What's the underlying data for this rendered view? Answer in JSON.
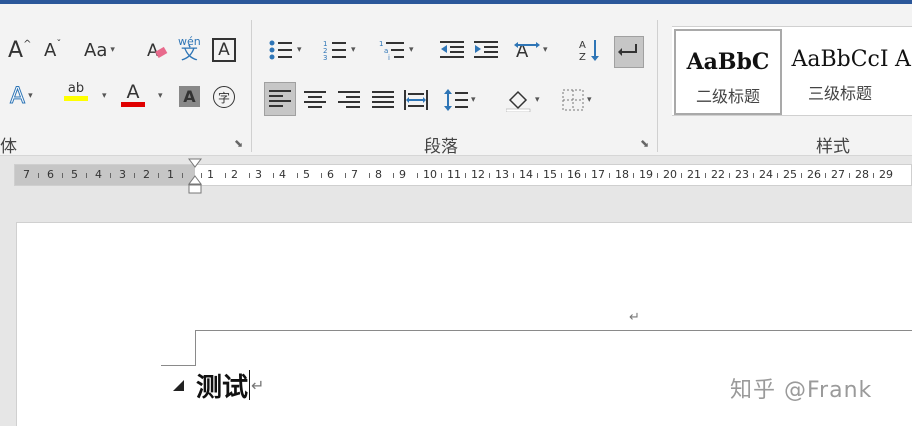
{
  "ribbon": {
    "groups": {
      "font_partial_label": "体",
      "paragraph_label": "段落",
      "styles_label": "样式"
    },
    "font_tools": {
      "grow_font": "A",
      "shrink_font": "A",
      "change_case": "Aa",
      "phonetic_top": "wén",
      "phonetic_bottom": "文",
      "char_border": "A",
      "text_effect": "A",
      "highlight": "ab",
      "font_color": "A",
      "char_shading": "A",
      "enclose": "字"
    },
    "styles": [
      {
        "preview": "AaBbC",
        "name": "二级标题",
        "selected": true
      },
      {
        "preview": "AaBbCcI",
        "name": "三级标题",
        "selected": false
      },
      {
        "preview": "A",
        "name": "",
        "selected": false
      }
    ]
  },
  "ruler": {
    "left_numbers": [
      "7",
      "6",
      "5",
      "4",
      "3",
      "2",
      "1"
    ],
    "right_numbers": [
      "1",
      "2",
      "3",
      "4",
      "5",
      "6",
      "7",
      "8",
      "9",
      "10",
      "11",
      "12",
      "13",
      "14",
      "15",
      "16",
      "17",
      "18",
      "19",
      "20",
      "21",
      "22",
      "23",
      "24",
      "25",
      "26",
      "27",
      "28",
      "29"
    ]
  },
  "document": {
    "header_return_mark": "↵",
    "heading_text": "测试",
    "heading_return_mark": "↵"
  },
  "watermark": "知乎 @Frank",
  "colors": {
    "title_bar": "#2b579a",
    "highlight_yellow": "#ffff00",
    "font_red": "#e00000",
    "bullet_blue": "#2e75b6"
  }
}
